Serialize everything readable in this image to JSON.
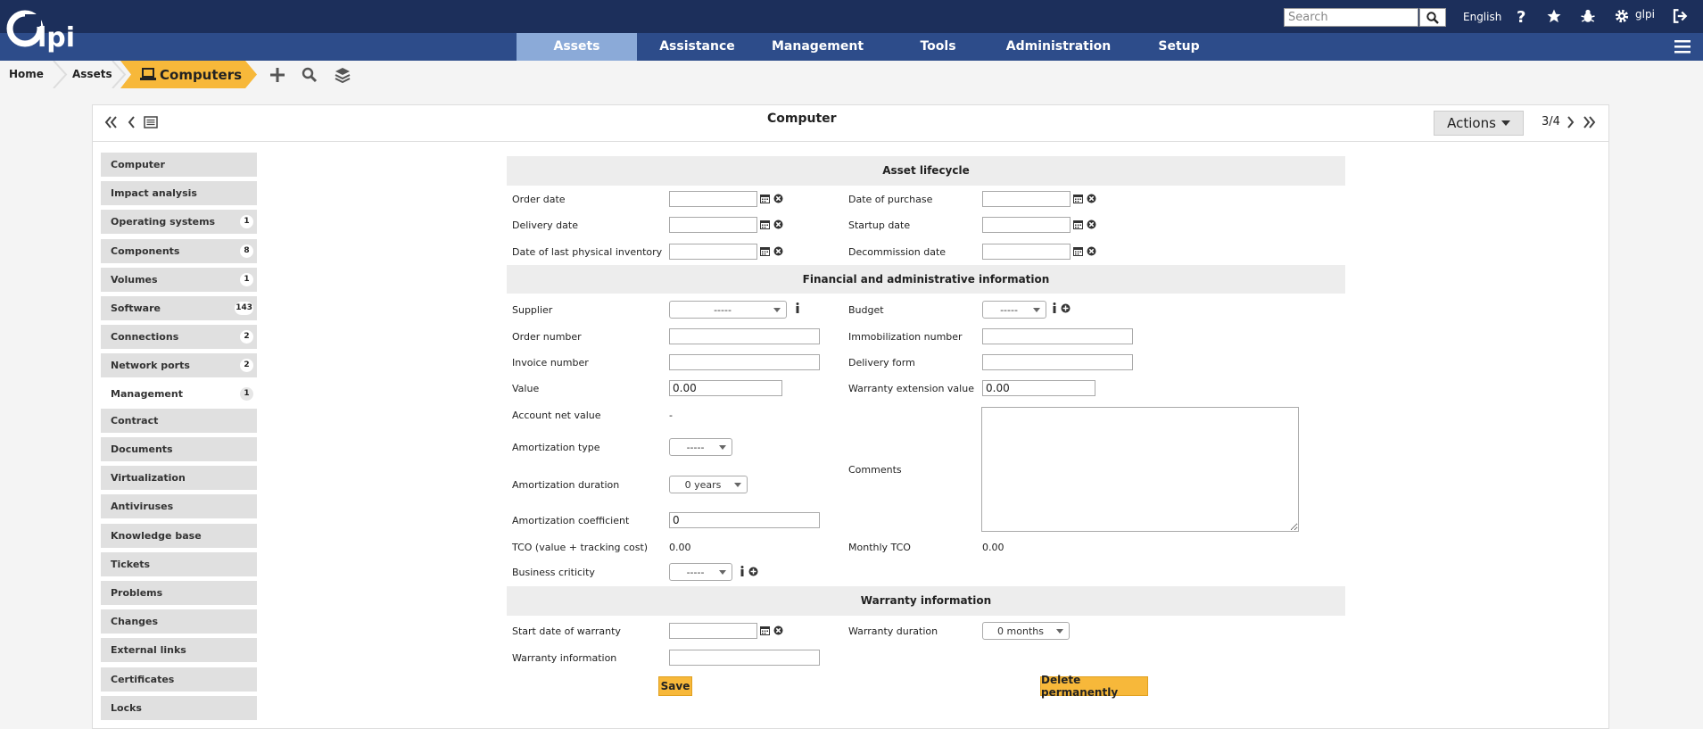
{
  "app": {
    "logo_text": "Glpi"
  },
  "topbar": {
    "search_placeholder": "Search",
    "language": "English",
    "user": "glpi",
    "icons": [
      "search-icon",
      "help-icon",
      "star-icon",
      "bug-icon",
      "gear-icon",
      "logout-icon",
      "hamburger-icon"
    ]
  },
  "nav": {
    "items": [
      "Assets",
      "Assistance",
      "Management",
      "Tools",
      "Administration",
      "Setup"
    ],
    "active": "Assets"
  },
  "breadcrumb": {
    "home": "Home",
    "assets": "Assets",
    "current": "Computers"
  },
  "form": {
    "title": "Computer",
    "actions_label": "Actions",
    "pager": "3/4"
  },
  "tabs": [
    {
      "label": "Computer",
      "count": ""
    },
    {
      "label": "Impact analysis",
      "count": ""
    },
    {
      "label": "Operating systems",
      "count": "1"
    },
    {
      "label": "Components",
      "count": "8"
    },
    {
      "label": "Volumes",
      "count": "1"
    },
    {
      "label": "Software",
      "count": "143"
    },
    {
      "label": "Connections",
      "count": "2"
    },
    {
      "label": "Network ports",
      "count": "2"
    },
    {
      "label": "Management",
      "count": "1"
    },
    {
      "label": "Contract",
      "count": ""
    },
    {
      "label": "Documents",
      "count": ""
    },
    {
      "label": "Virtualization",
      "count": ""
    },
    {
      "label": "Antiviruses",
      "count": ""
    },
    {
      "label": "Knowledge base",
      "count": ""
    },
    {
      "label": "Tickets",
      "count": ""
    },
    {
      "label": "Problems",
      "count": ""
    },
    {
      "label": "Changes",
      "count": ""
    },
    {
      "label": "External links",
      "count": ""
    },
    {
      "label": "Certificates",
      "count": ""
    },
    {
      "label": "Locks",
      "count": ""
    }
  ],
  "active_tab": "Management",
  "sections": {
    "lifecycle": "Asset lifecycle",
    "financial": "Financial and administrative information",
    "warranty": "Warranty information"
  },
  "fields": {
    "order_date": "Order date",
    "date_of_purchase": "Date of purchase",
    "delivery_date": "Delivery date",
    "startup_date": "Startup date",
    "last_inventory": "Date of last physical inventory",
    "decommission_date": "Decommission date",
    "supplier": "Supplier",
    "supplier_value": "-----",
    "budget": "Budget",
    "budget_value": "-----",
    "order_number": "Order number",
    "immobilization_number": "Immobilization number",
    "invoice_number": "Invoice number",
    "delivery_form": "Delivery form",
    "value": "Value",
    "value_val": "0.00",
    "warranty_ext_value": "Warranty extension value",
    "warranty_ext_val": "0.00",
    "account_net_value": "Account net value",
    "account_net_val": "-",
    "amortization_type": "Amortization type",
    "amortization_type_val": "-----",
    "comments": "Comments",
    "amortization_duration": "Amortization duration",
    "amortization_duration_val": "0 years",
    "amortization_coefficient": "Amortization coefficient",
    "amortization_coefficient_val": "0",
    "tco": "TCO (value + tracking cost)",
    "tco_val": "0.00",
    "monthly_tco": "Monthly TCO",
    "monthly_tco_val": "0.00",
    "business_criticity": "Business criticity",
    "business_criticity_val": "-----",
    "start_warranty": "Start date of warranty",
    "warranty_duration": "Warranty duration",
    "warranty_duration_val": "0 months",
    "warranty_info": "Warranty information"
  },
  "buttons": {
    "save": "Save",
    "delete": "Delete permanently"
  },
  "colors": {
    "topbar": "#1c2f5b",
    "navbar": "#2d4c8a",
    "nav_active": "#8baad8",
    "accent": "#f7b83a"
  }
}
